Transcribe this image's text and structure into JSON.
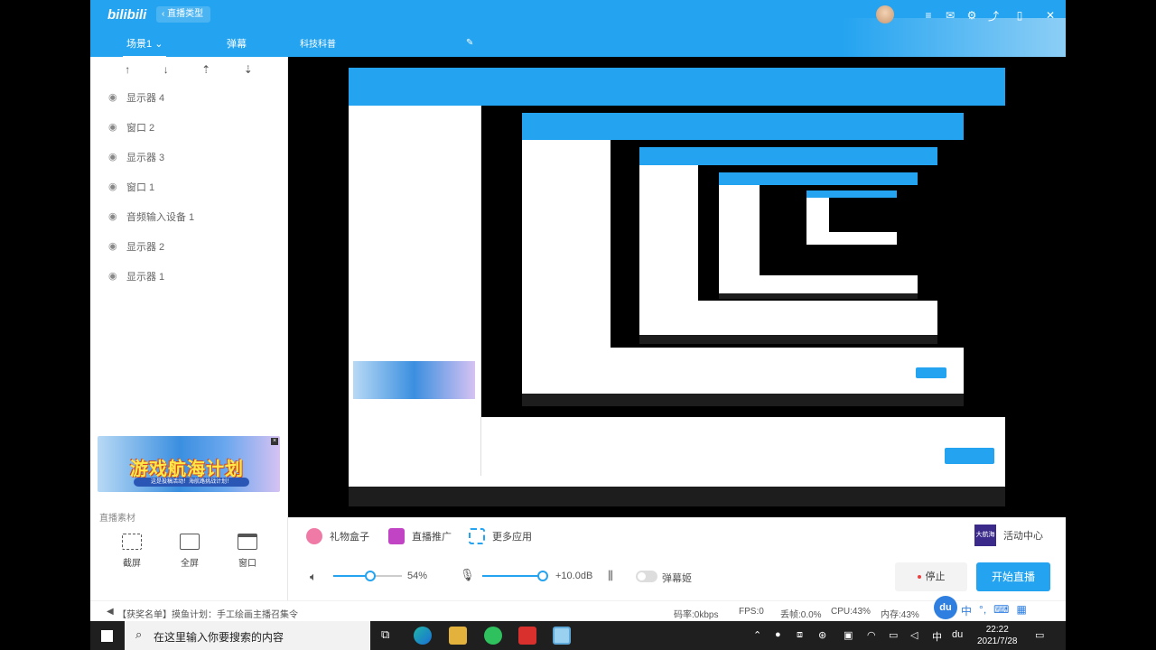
{
  "app": {
    "logo": "bilibili",
    "back_label": "直播类型",
    "tabs": [
      {
        "label": "场景1"
      },
      {
        "label": "弹幕"
      },
      {
        "label": "科技科普"
      }
    ]
  },
  "sidebar": {
    "sources": [
      {
        "label": "显示器 4"
      },
      {
        "label": "窗口 2"
      },
      {
        "label": "显示器 3"
      },
      {
        "label": "窗口 1"
      },
      {
        "label": "音频输入设备 1"
      },
      {
        "label": "显示器 2"
      },
      {
        "label": "显示器 1"
      }
    ],
    "banner_title": "游戏航海计划",
    "banner_sub": "这是投稿活动！海航路挑战计划！",
    "material_label": "直播素材",
    "materials": [
      {
        "label": "截屏"
      },
      {
        "label": "全屏"
      },
      {
        "label": "窗口"
      }
    ]
  },
  "panel": {
    "tools": [
      {
        "label": "礼物盒子"
      },
      {
        "label": "直播推广"
      },
      {
        "label": "更多应用"
      }
    ],
    "activity_logo": "大航海",
    "activity_label": "活动中心",
    "volume_percent": "54%",
    "volume_level": 0.54,
    "mic_db": "+10.0dB",
    "mic_level": 1.0,
    "danmaku_label": "弹幕姬",
    "stop_label": "停止",
    "start_label": "开始直播"
  },
  "statusbar": {
    "ticker": "【获奖名单】摸鱼计划：手工绘画主播召集令",
    "bitrate": "码率:0kbps",
    "fps": "FPS:0",
    "drop": "丢帧:0.0%",
    "cpu": "CPU:43%",
    "mem": "内存:43%",
    "ime_lang": "中"
  },
  "taskbar": {
    "search_placeholder": "在这里输入你要搜索的内容",
    "time": "22:22",
    "date": "2021/7/28",
    "ime": "中"
  },
  "colors": {
    "brand_blue": "#23a3f0",
    "stop_dot": "#e84040"
  }
}
